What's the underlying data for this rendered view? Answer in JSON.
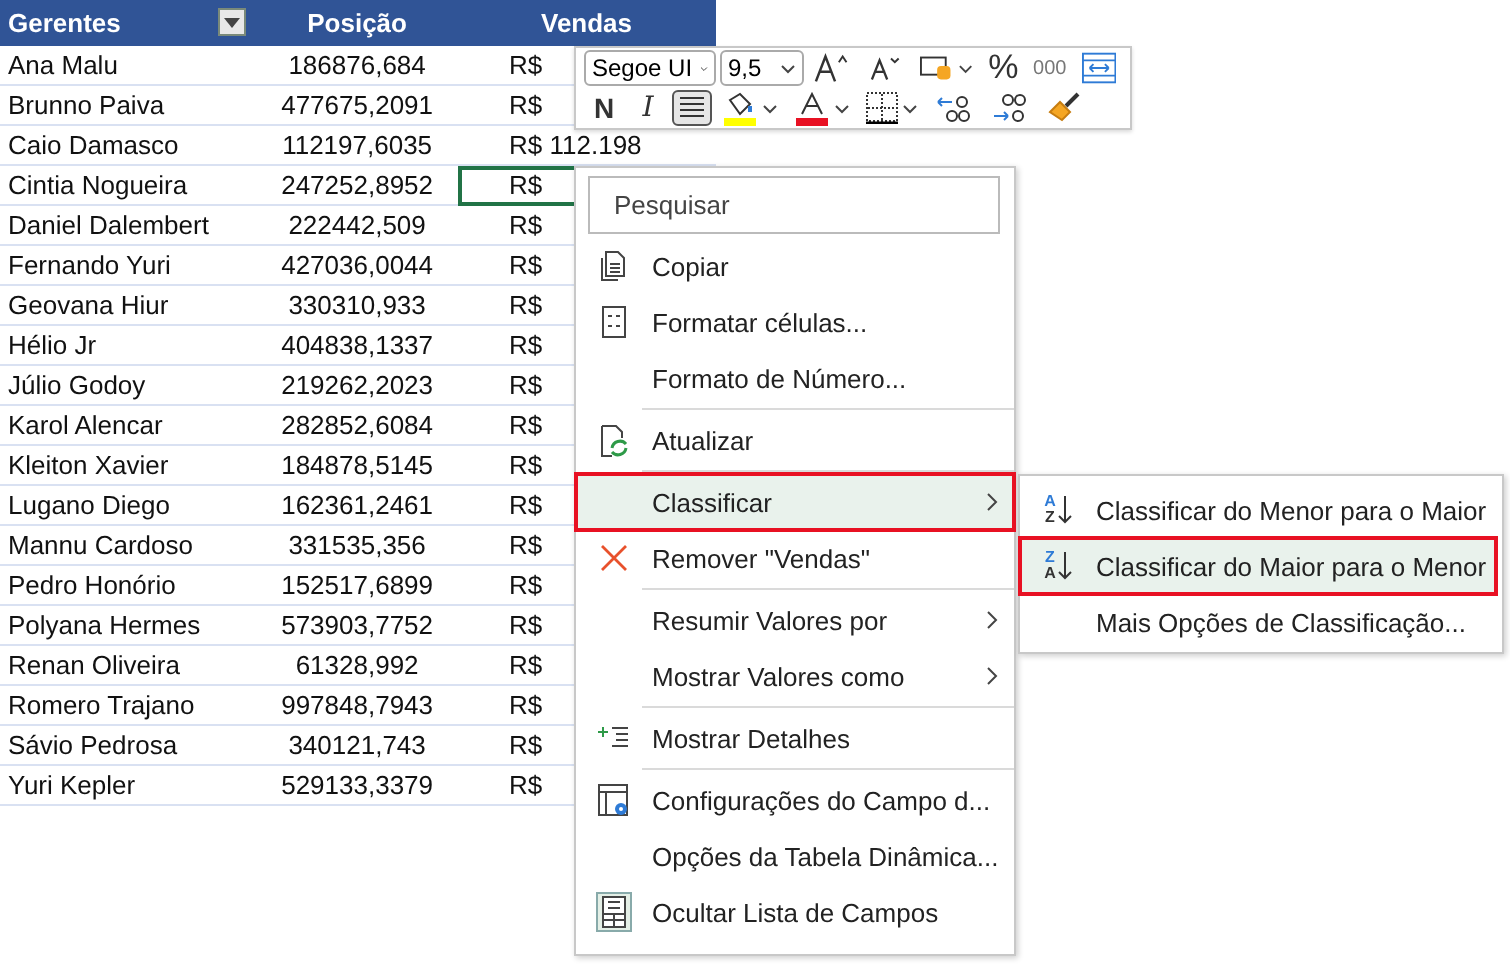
{
  "table": {
    "columns": [
      {
        "label": "Gerentes",
        "filter": true
      },
      {
        "label": "Posição",
        "filter": false
      },
      {
        "label": "Vendas",
        "filter": false
      }
    ],
    "rows": [
      {
        "cells": [
          "Ana Malu",
          "186876,684",
          "R$"
        ],
        "selected": false
      },
      {
        "cells": [
          "Brunno Paiva",
          "477675,2091",
          "R$"
        ],
        "selected": false
      },
      {
        "cells": [
          "Caio Damasco",
          "112197,6035",
          "R$ 112.198"
        ],
        "selected": false
      },
      {
        "cells": [
          "Cintia Nogueira",
          "247252,8952",
          "R$"
        ],
        "selected": true
      },
      {
        "cells": [
          "Daniel Dalembert",
          "222442,509",
          "R$"
        ],
        "selected": false
      },
      {
        "cells": [
          "Fernando Yuri",
          "427036,0044",
          "R$"
        ],
        "selected": false
      },
      {
        "cells": [
          "Geovana Hiur",
          "330310,933",
          "R$"
        ],
        "selected": false
      },
      {
        "cells": [
          "Hélio Jr",
          "404838,1337",
          "R$"
        ],
        "selected": false
      },
      {
        "cells": [
          "Júlio Godoy",
          "219262,2023",
          "R$"
        ],
        "selected": false
      },
      {
        "cells": [
          "Karol Alencar",
          "282852,6084",
          "R$"
        ],
        "selected": false
      },
      {
        "cells": [
          "Kleiton Xavier",
          "184878,5145",
          "R$"
        ],
        "selected": false
      },
      {
        "cells": [
          "Lugano Diego",
          "162361,2461",
          "R$"
        ],
        "selected": false
      },
      {
        "cells": [
          "Mannu Cardoso",
          "331535,356",
          "R$"
        ],
        "selected": false
      },
      {
        "cells": [
          "Pedro Honório",
          "152517,6899",
          "R$"
        ],
        "selected": false
      },
      {
        "cells": [
          "Polyana Hermes",
          "573903,7752",
          "R$"
        ],
        "selected": false
      },
      {
        "cells": [
          "Renan Oliveira",
          "61328,992",
          "R$"
        ],
        "selected": false
      },
      {
        "cells": [
          "Romero Trajano",
          "997848,7943",
          "R$"
        ],
        "selected": false
      },
      {
        "cells": [
          "Sávio Pedrosa",
          "340121,743",
          "R$"
        ],
        "selected": false
      },
      {
        "cells": [
          "Yuri Kepler",
          "529133,3379",
          "R$"
        ],
        "selected": false
      }
    ]
  },
  "toolbar": {
    "lines": [
      {
        "items": [
          {
            "kind": "font-field",
            "label": "Segoe UI"
          },
          {
            "kind": "size-field",
            "label": "9,5"
          },
          {
            "kind": "grow-font"
          },
          {
            "kind": "shrink-font"
          },
          {
            "kind": "cell-styles"
          },
          {
            "kind": "text",
            "label": "%",
            "pressed": false
          },
          {
            "kind": "small-text",
            "label": "000",
            "pressed": false
          },
          {
            "kind": "merge"
          }
        ]
      },
      {
        "items": [
          {
            "kind": "text",
            "label": "N",
            "pressed": false
          },
          {
            "kind": "italic",
            "label": "I",
            "pressed": false
          },
          {
            "kind": "align",
            "pressed": true
          },
          {
            "kind": "fill-color",
            "color": "#ffff00"
          },
          {
            "kind": "font-color",
            "color": "#e81123"
          },
          {
            "kind": "borders"
          },
          {
            "kind": "inc-decimal"
          },
          {
            "kind": "dec-decimal"
          },
          {
            "kind": "painter"
          }
        ]
      }
    ]
  },
  "context_menu": {
    "search_placeholder": "Pesquisar",
    "items": [
      {
        "kind": "copy",
        "label": "Copiar",
        "selected": false,
        "submenu": false
      },
      {
        "kind": "format-cells",
        "label": "Formatar células...",
        "selected": false,
        "submenu": false
      },
      {
        "kind": "plain",
        "label": "Formato de Número...",
        "selected": false,
        "submenu": false
      },
      {
        "kind": "separator"
      },
      {
        "kind": "refresh",
        "label": "Atualizar",
        "selected": false,
        "submenu": false
      },
      {
        "kind": "separator"
      },
      {
        "kind": "plain",
        "label": "Classificar",
        "selected": true,
        "submenu": true
      },
      {
        "kind": "remove",
        "label": "Remover \"Vendas\"",
        "selected": false,
        "submenu": false
      },
      {
        "kind": "separator"
      },
      {
        "kind": "plain",
        "label": "Resumir Valores por",
        "selected": false,
        "submenu": true
      },
      {
        "kind": "plain",
        "label": "Mostrar Valores como",
        "selected": false,
        "submenu": true
      },
      {
        "kind": "separator"
      },
      {
        "kind": "details",
        "label": "Mostrar Detalhes",
        "selected": false,
        "submenu": false
      },
      {
        "kind": "separator"
      },
      {
        "kind": "field-settings",
        "label": "Configurações do Campo d...",
        "selected": false,
        "submenu": false
      },
      {
        "kind": "plain",
        "label": "Opções da Tabela Dinâmica...",
        "selected": false,
        "submenu": false
      },
      {
        "kind": "field-list",
        "label": "Ocultar Lista de Campos",
        "selected": false,
        "submenu": false
      }
    ]
  },
  "submenu": {
    "items": [
      {
        "kind": "sort",
        "icon_letters": [
          "A",
          "Z"
        ],
        "label": "Classificar do Menor para o Maior",
        "selected": false
      },
      {
        "kind": "sort",
        "icon_letters": [
          "Z",
          "A"
        ],
        "label": "Classificar do Maior para o Menor",
        "selected": true
      },
      {
        "kind": "plain",
        "label": "Mais Opções de Classificação...",
        "selected": false
      }
    ]
  }
}
